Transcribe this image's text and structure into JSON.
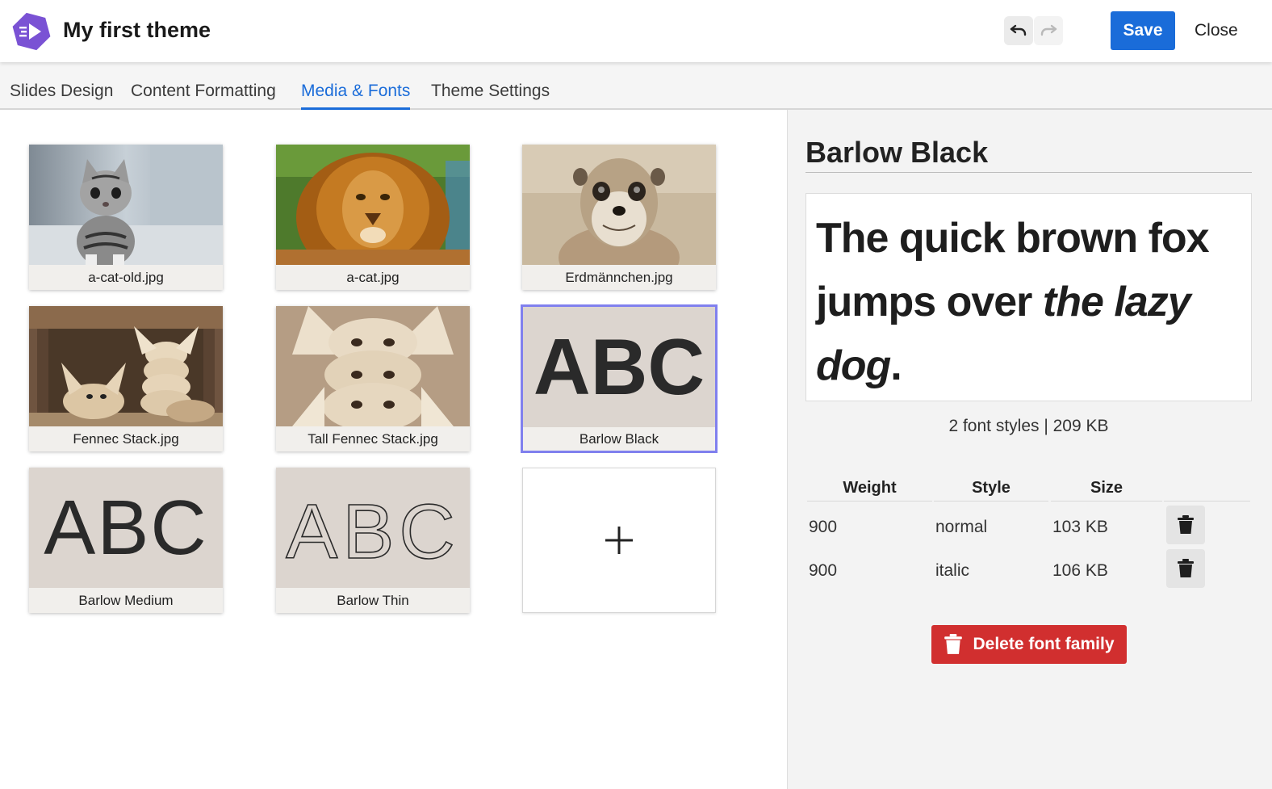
{
  "app": {
    "title": "My first theme",
    "logo_icon": "play-logo-icon",
    "undo_icon": "undo-icon",
    "redo_icon": "redo-icon",
    "save_label": "Save",
    "close_label": "Close",
    "accent": "#1a6cd9"
  },
  "tabs": [
    {
      "label": "Slides Design",
      "active": false
    },
    {
      "label": "Content Formatting",
      "active": false
    },
    {
      "label": "Media & Fonts",
      "active": true
    },
    {
      "label": "Theme Settings",
      "active": false
    }
  ],
  "media": [
    {
      "name": "a-cat-old.jpg",
      "kind": "image"
    },
    {
      "name": "a-cat.jpg",
      "kind": "image"
    },
    {
      "name": "Erdmännchen.jpg",
      "kind": "image"
    },
    {
      "name": "Fennec Stack.jpg",
      "kind": "image"
    },
    {
      "name": "Tall Fennec Stack.jpg",
      "kind": "image"
    },
    {
      "name": "Barlow Black",
      "kind": "font",
      "sample": "ABC",
      "selected": true
    },
    {
      "name": "Barlow Medium",
      "kind": "font",
      "sample": "ABC"
    },
    {
      "name": "Barlow Thin",
      "kind": "font",
      "sample": "ABC"
    }
  ],
  "add_tile": {
    "icon": "plus-icon",
    "glyph": "+"
  },
  "detail": {
    "font_name": "Barlow Black",
    "preview_normal": "The quick brown fox jumps over ",
    "preview_italic": "the lazy dog",
    "preview_end": ".",
    "meta": "2 font styles | 209 KB",
    "columns": [
      "Weight",
      "Style",
      "Size"
    ],
    "styles": [
      {
        "weight": "900",
        "style": "normal",
        "size": "103 KB"
      },
      {
        "weight": "900",
        "style": "italic",
        "size": "106 KB"
      }
    ],
    "delete_label": "Delete font family",
    "delete_color": "#d12f2f"
  }
}
